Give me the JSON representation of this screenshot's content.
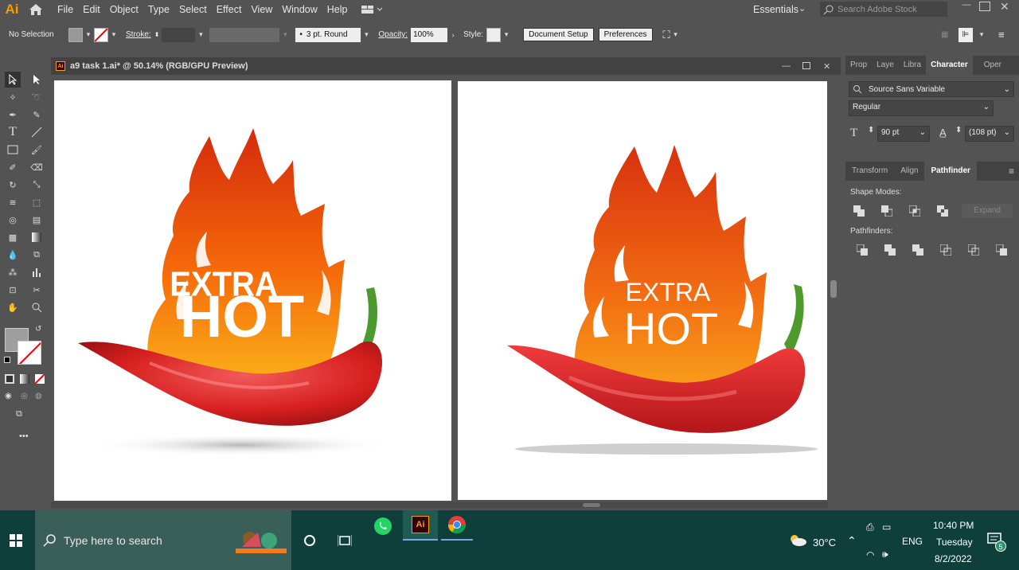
{
  "app": {
    "logo": "Ai"
  },
  "menu": [
    "File",
    "Edit",
    "Object",
    "Type",
    "Select",
    "Effect",
    "View",
    "Window",
    "Help"
  ],
  "workspace": "Essentials",
  "search_placeholder": "Search Adobe Stock",
  "control": {
    "selection": "No Selection",
    "stroke_label": "Stroke:",
    "brush": "3 pt. Round",
    "opacity_label": "Opacity:",
    "opacity": "100%",
    "style_label": "Style:",
    "document_setup": "Document Setup",
    "preferences": "Preferences"
  },
  "document": {
    "title": "a9 task 1.ai* @ 50.14% (RGB/GPU Preview)"
  },
  "artwork": {
    "left": {
      "line1": "EXTRA",
      "line2": "HOT"
    },
    "right": {
      "line1": "EXTRA",
      "line2": "HOT"
    }
  },
  "panel_top": {
    "tabs": [
      "Prop",
      "Laye",
      "Libra",
      "Character",
      "Oper"
    ],
    "active_tab": "Character",
    "font": "Source Sans Variable",
    "style": "Regular",
    "size": "90 pt",
    "leading": "(108 pt)"
  },
  "panel_mid": {
    "tabs": [
      "Transform",
      "Align",
      "Pathfinder"
    ],
    "active_tab": "Pathfinder",
    "shape_modes": "Shape Modes:",
    "expand": "Expand",
    "pathfinders": "Pathfinders:"
  },
  "taskbar": {
    "search": "Type here to search",
    "weather": "30°C",
    "lang": "ENG",
    "time": "10:40 PM",
    "day": "Tuesday",
    "date": "8/2/2022",
    "notifications": "5"
  }
}
